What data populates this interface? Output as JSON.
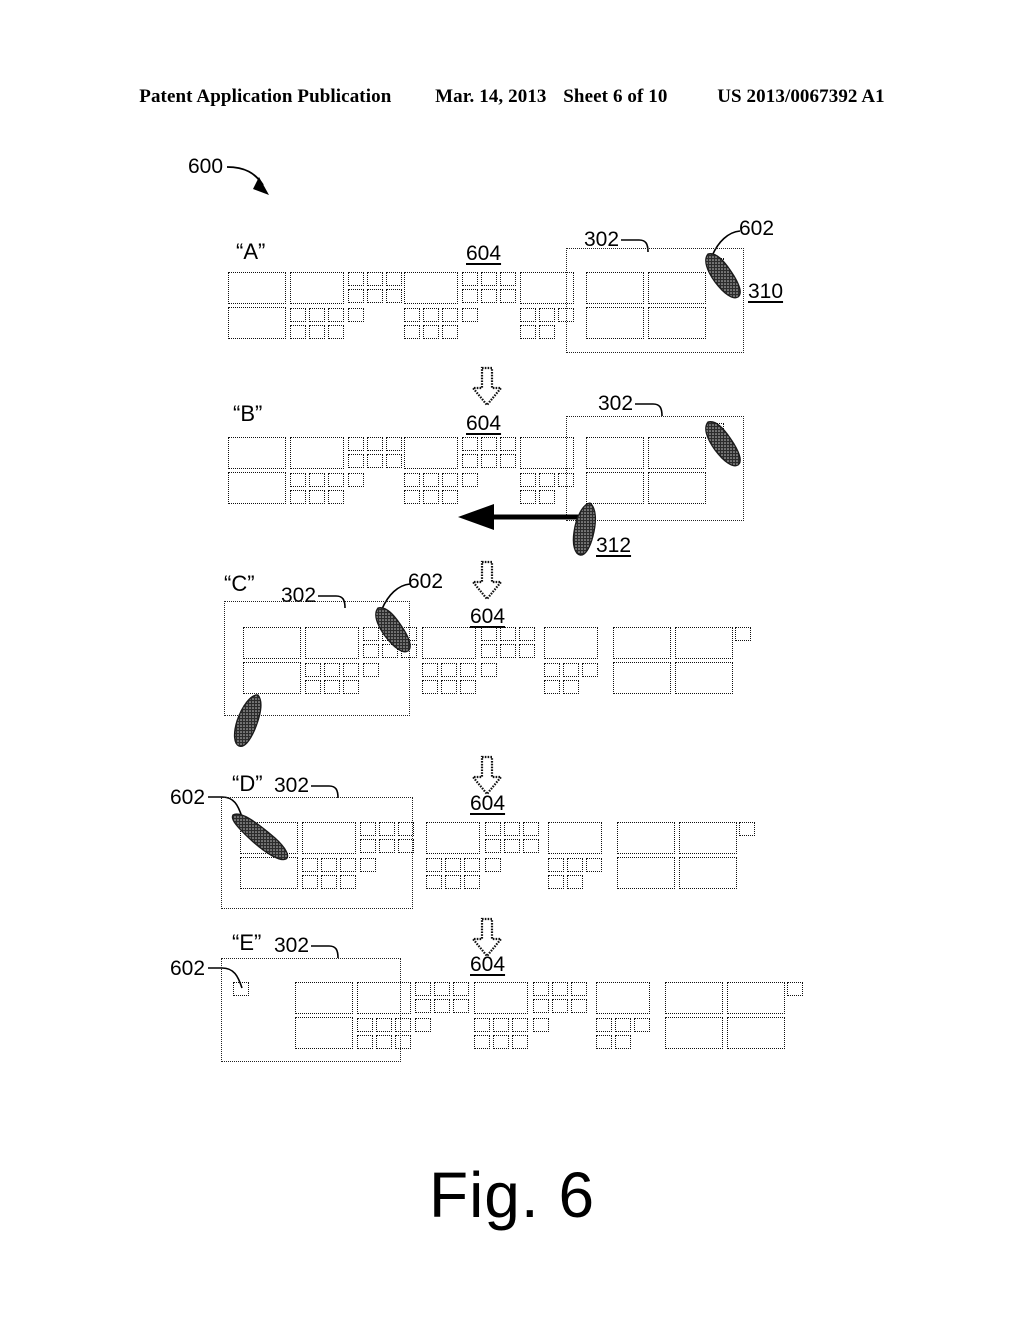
{
  "header": {
    "publication": "Patent Application Publication",
    "date": "Mar. 14, 2013",
    "sheet": "Sheet 6 of 10",
    "pub_number": "US 2013/0067392 A1"
  },
  "figure": {
    "caption": "Fig. 6",
    "figure_ref": "600",
    "panels": [
      {
        "id": "A",
        "label": "“A”",
        "viewport_ref": "302",
        "list_ref": "604",
        "cursor_refs": [
          "602",
          "310"
        ],
        "description": "Horizontally scrollable tile list with viewport at right; touch cursor at top-right corner of viewport"
      },
      {
        "id": "B",
        "label": "“B”",
        "viewport_ref": "302",
        "list_ref": "604",
        "cursor_refs": [
          "312"
        ],
        "description": "Second touch cursor drags leftward; leftward drag arrow shown"
      },
      {
        "id": "C",
        "label": "“C”",
        "viewport_ref": "302",
        "list_ref": "604",
        "cursor_refs": [
          "602"
        ],
        "description": "Viewport moved to left; content scrolled; cursor inside viewport upper area and a second cursor at lower-left"
      },
      {
        "id": "D",
        "label": "“D”",
        "viewport_ref": "302",
        "list_ref": "604",
        "cursor_refs": [
          "602"
        ],
        "description": "Cursor at top-left inside viewport"
      },
      {
        "id": "E",
        "label": "“E”",
        "viewport_ref": "302",
        "list_ref": "604",
        "cursor_refs": [
          "602"
        ],
        "description": "Cursor replaced by small square at viewport left edge"
      }
    ],
    "reference_numerals": {
      "overall": "600",
      "viewport": "302",
      "content_list": "604",
      "cursor": "602",
      "touch_point_first": "310",
      "touch_point_second": "312"
    }
  },
  "colors": {
    "ink": "#000000",
    "line": "#111111",
    "paper": "#ffffff",
    "cursor_fill": "#3a3a3a"
  }
}
